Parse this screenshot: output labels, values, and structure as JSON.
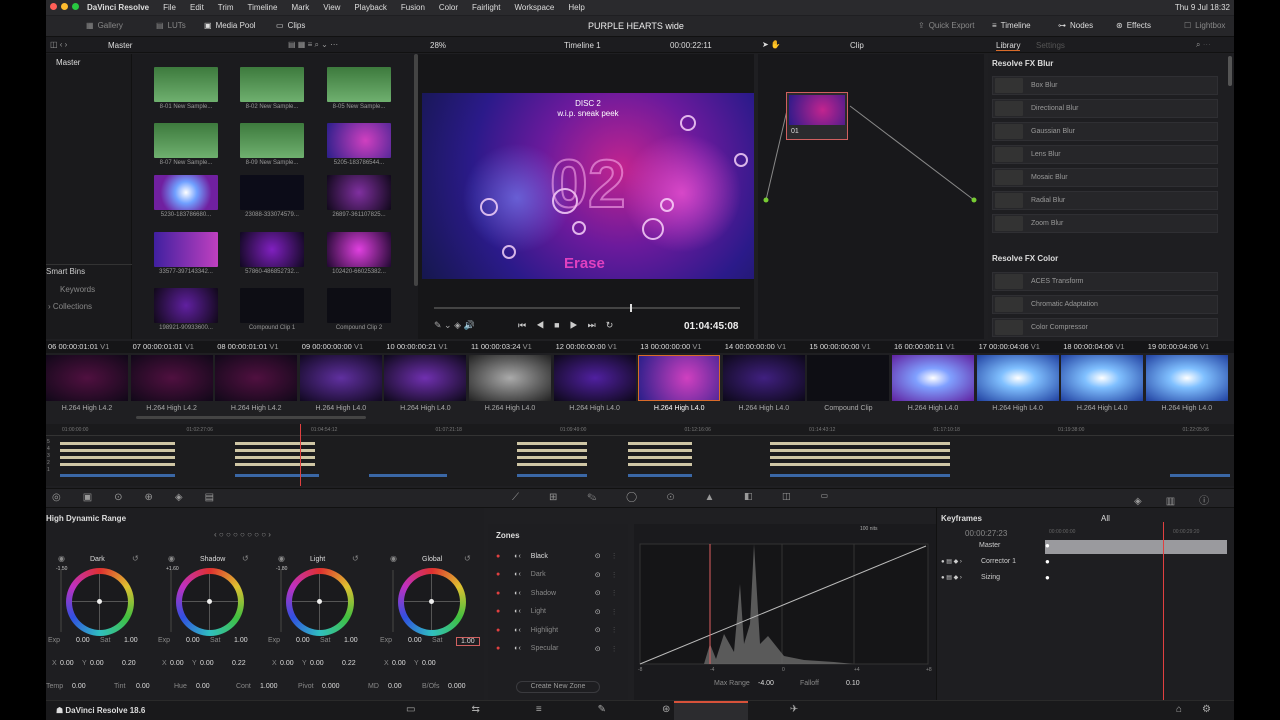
{
  "menubar": {
    "app": "DaVinci Resolve",
    "items": [
      "File",
      "Edit",
      "Trim",
      "Timeline",
      "Mark",
      "View",
      "Playback",
      "Fusion",
      "Color",
      "Fairlight",
      "Workspace",
      "Help"
    ],
    "datetime": "Thu 9 Jul  18:32"
  },
  "toolbar": {
    "gallery": "Gallery",
    "luts": "LUTs",
    "media_pool": "Media Pool",
    "clips": "Clips",
    "project": "PURPLE HEARTS wide",
    "quick_export": "Quick Export",
    "timeline": "Timeline",
    "nodes": "Nodes",
    "effects": "Effects",
    "lightbox": "Lightbox"
  },
  "sub": {
    "folder": "Master",
    "zoom": "28%",
    "timeline": "Timeline 1",
    "timecode": "00:00:22:11",
    "clip": "Clip",
    "library": "Library",
    "settings": "Settings"
  },
  "media_pool": {
    "root": "Master",
    "smart_bins": "Smart Bins",
    "keywords": "Keywords",
    "collections": "Collections",
    "items": [
      "8-01 New Sample...",
      "8-02 New Sample...",
      "8-05 New Sample...",
      "8-07 New Sample...",
      "8-09 New Sample...",
      "5205-183786544...",
      "5230-183786680...",
      "23088-333074579...",
      "26897-361107825...",
      "33577-397143342...",
      "57860-486852732...",
      "102420-66025382...",
      "198921-90933600...",
      "Compound Clip 1",
      "Compound Clip 2"
    ]
  },
  "viewer": {
    "title_line1": "DISC 2",
    "title_line2": "w.i.p. sneak peek",
    "big": "02",
    "erase": "Erase",
    "timecode": "01:04:45:08"
  },
  "node": {
    "label": "01"
  },
  "library": {
    "section1": "Resolve FX Blur",
    "blur": [
      "Box Blur",
      "Directional Blur",
      "Gaussian Blur",
      "Lens Blur",
      "Mosaic Blur",
      "Radial Blur",
      "Zoom Blur"
    ],
    "section2": "Resolve FX Color",
    "color": [
      "ACES Transform",
      "Chromatic Adaptation",
      "Color Compressor"
    ]
  },
  "timeline": {
    "clips": [
      {
        "num": "06",
        "tc": "00:00:01:01",
        "track": "V1",
        "codec": "H.264 High L4.2"
      },
      {
        "num": "07",
        "tc": "00:00:01:01",
        "track": "V1",
        "codec": "H.264 High L4.2"
      },
      {
        "num": "08",
        "tc": "00:00:01:01",
        "track": "V1",
        "codec": "H.264 High L4.2"
      },
      {
        "num": "09",
        "tc": "00:00:00:00",
        "track": "V1",
        "codec": "H.264 High L4.0"
      },
      {
        "num": "10",
        "tc": "00:00:00:21",
        "track": "V1",
        "codec": "H.264 High L4.0"
      },
      {
        "num": "11",
        "tc": "00:00:03:24",
        "track": "V1",
        "codec": "H.264 High L4.0"
      },
      {
        "num": "12",
        "tc": "00:00:00:00",
        "track": "V1",
        "codec": "H.264 High L4.0"
      },
      {
        "num": "13",
        "tc": "00:00:00:00",
        "track": "V1",
        "codec": "H.264 High L4.0"
      },
      {
        "num": "14",
        "tc": "00:00:00:00",
        "track": "V1",
        "codec": "H.264 High L4.0"
      },
      {
        "num": "15",
        "tc": "00:00:00:00",
        "track": "V1",
        "codec": "Compound Clip"
      },
      {
        "num": "16",
        "tc": "00:00:00:11",
        "track": "V1",
        "codec": "H.264 High L4.0"
      },
      {
        "num": "17",
        "tc": "00:00:04:06",
        "track": "V1",
        "codec": "H.264 High L4.0"
      },
      {
        "num": "18",
        "tc": "00:00:04:06",
        "track": "V1",
        "codec": "H.264 High L4.0"
      },
      {
        "num": "19",
        "tc": "00:00:04:06",
        "track": "V1",
        "codec": "H.264 High L4.0"
      }
    ],
    "ruler": [
      "01:00:00:00",
      "01:02:27:06",
      "01:04:54:12",
      "01:07:21:18",
      "01:09:49:00",
      "01:12:16:06",
      "01:14:43:12",
      "01:17:10:18",
      "01:19:38:00",
      "01:22:05:06"
    ],
    "track_nums": [
      "5",
      "4",
      "3",
      "2",
      "1"
    ]
  },
  "hdr": {
    "title": "High Dynamic Range",
    "wheels": [
      {
        "name": "Dark",
        "val": "-1.50",
        "exp": "0.00",
        "sat": "1.00",
        "x": "0.00",
        "y": "0.00",
        "z": "0.20"
      },
      {
        "name": "Shadow",
        "val": "+1.60",
        "exp": "0.00",
        "sat": "1.00",
        "x": "0.00",
        "y": "0.00",
        "z": "0.22"
      },
      {
        "name": "Light",
        "val": "-1.80",
        "exp": "0.00",
        "sat": "1.00",
        "x": "0.00",
        "y": "0.00",
        "z": "0.22"
      },
      {
        "name": "Global",
        "val": "",
        "exp": "0.00",
        "sat": "1.00",
        "x": "0.00",
        "y": "0.00",
        "z": ""
      }
    ],
    "bottom": {
      "temp": "0.00",
      "tint": "0.00",
      "hue": "0.00",
      "cont": "1.000",
      "pivot": "0.000",
      "md": "0.00",
      "bofs": "0.000"
    },
    "labels": {
      "exp": "Exp",
      "sat": "Sat",
      "temp": "Temp",
      "tint": "Tint",
      "hue": "Hue",
      "cont": "Cont",
      "pivot": "Pivot",
      "md": "MD",
      "bofs": "B/Ofs"
    }
  },
  "zones": {
    "title": "Zones",
    "items": [
      "Black",
      "Dark",
      "Shadow",
      "Light",
      "Highlight",
      "Specular"
    ],
    "create": "Create New Zone"
  },
  "curve": {
    "max_range_label": "Max Range",
    "max_range": "-4.00",
    "falloff_label": "Falloff",
    "falloff": "0.10",
    "nits": "100 nits",
    "ticks": [
      "-8",
      "-4",
      "0",
      "+4",
      "+8"
    ]
  },
  "keyframes": {
    "title": "Keyframes",
    "filter": "All",
    "tc": "00:00:27:23",
    "tc_start": "00:00:00:00",
    "tc_end": "00:00:29:20",
    "rows": [
      "Master",
      "Corrector 1",
      "Sizing"
    ]
  },
  "footer": {
    "app": "DaVinci Resolve 18.6"
  }
}
